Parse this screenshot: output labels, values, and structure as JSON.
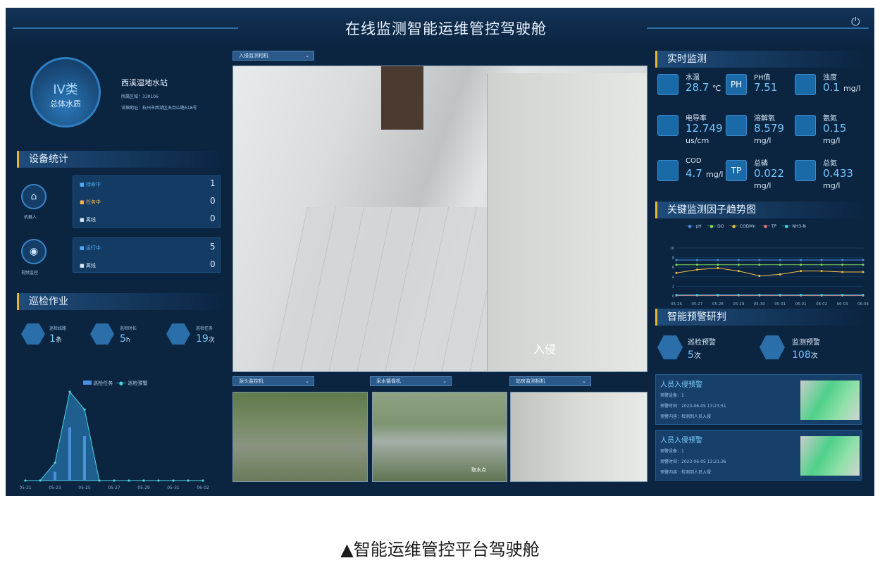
{
  "header": {
    "title": "在线监测智能运维管控驾驶舱"
  },
  "station": {
    "water_class": "IV类",
    "water_quality_label": "总体水质",
    "name": "西溪湿地水站",
    "region_label": "所属区域：",
    "region_value": "330106",
    "address_label": "详细地址：",
    "address_value": "杭州市西湖区天目山路518号"
  },
  "device_stats": {
    "title": "设备统计",
    "robot": {
      "label": "机器人",
      "rows": [
        {
          "label": "待命中",
          "value": "1"
        },
        {
          "label": "任务中",
          "value": "0"
        },
        {
          "label": "离线",
          "value": "0"
        }
      ]
    },
    "video": {
      "label": "视频监控",
      "rows": [
        {
          "label": "运行中",
          "value": "5"
        },
        {
          "label": "离线",
          "value": "0"
        }
      ]
    }
  },
  "inspection": {
    "title": "巡检作业",
    "items": [
      {
        "label": "巡检线路",
        "value": "1",
        "unit": "条"
      },
      {
        "label": "巡检时长",
        "value": "5",
        "unit": "h"
      },
      {
        "label": "巡检任务",
        "value": "19",
        "unit": "次"
      }
    ],
    "legend": [
      "巡检任务",
      "巡检预警"
    ],
    "x_ticks": [
      "05-21",
      "05-23",
      "05-25",
      "05-27",
      "05-29",
      "05-31",
      "06-02"
    ]
  },
  "cameras": {
    "main_select": "入侵监测相机",
    "main_overlay": "入侵",
    "sub": [
      {
        "label": "源头监控机"
      },
      {
        "label": "采水摄像机"
      },
      {
        "label": "站房监测相机"
      }
    ],
    "sub_overlay": "取水点"
  },
  "realtime": {
    "title": "实时监测",
    "items": [
      {
        "label": "水温",
        "value": "28.7",
        "unit": "℃",
        "icon": "thermometer-icon"
      },
      {
        "label": "PH值",
        "value": "7.51",
        "unit": "",
        "icon": "ph-icon",
        "badge": "PH"
      },
      {
        "label": "浊度",
        "value": "0.1",
        "unit": "mg/l",
        "icon": "drop-icon"
      },
      {
        "label": "电导率",
        "value": "12.749",
        "unit": "us/cm",
        "icon": "bolt-icon"
      },
      {
        "label": "溶解氧",
        "value": "8.579",
        "unit": "mg/l",
        "icon": "oxygen-icon"
      },
      {
        "label": "氨氮",
        "value": "0.15",
        "unit": "mg/l",
        "icon": "ammonia-icon"
      },
      {
        "label": "COD",
        "value": "4.7",
        "unit": "mg/l",
        "icon": "beaker-icon"
      },
      {
        "label": "总磷",
        "value": "0.022",
        "unit": "mg/l",
        "icon": "tp-icon",
        "badge": "TP"
      },
      {
        "label": "总氮",
        "value": "0.433",
        "unit": "mg/l",
        "icon": "tn-icon"
      }
    ]
  },
  "trend": {
    "title": "关键监测因子趋势图",
    "legend": [
      {
        "name": "pH",
        "color": "#4a8fe0"
      },
      {
        "name": "DO",
        "color": "#7ed957"
      },
      {
        "name": "CODMn",
        "color": "#f0c04a"
      },
      {
        "name": "TP",
        "color": "#f07a7a"
      },
      {
        "name": "NH3-N",
        "color": "#4fd3e0"
      }
    ],
    "y_ticks": [
      "10",
      "8",
      "6",
      "4",
      "2",
      "0"
    ],
    "x_ticks": [
      "05-26",
      "05-27",
      "05-28",
      "05-29",
      "05-30",
      "05-31",
      "06-01",
      "06-02",
      "06-03",
      "06-04"
    ]
  },
  "warning": {
    "title": "智能预警研判",
    "items": [
      {
        "label": "巡检预警",
        "value": "5",
        "unit": "次"
      },
      {
        "label": "监测预警",
        "value": "108",
        "unit": "次"
      }
    ],
    "alerts": [
      {
        "title": "人员入侵预警",
        "device": "预警设备：1",
        "time": "预警时间：2023-06-05 13:23:51",
        "content": "预警内容：检测到人员入侵"
      },
      {
        "title": "人员入侵预警",
        "device": "预警设备：1",
        "time": "预警时间：2023-06-05 13:21:36",
        "content": "预警内容：检测到人员入侵"
      }
    ]
  },
  "chart_data": [
    {
      "type": "line",
      "title": "关键监测因子趋势图",
      "x": [
        "05-26",
        "05-27",
        "05-28",
        "05-29",
        "05-30",
        "05-31",
        "06-01",
        "06-02",
        "06-03",
        "06-04"
      ],
      "ylim": [
        0,
        10
      ],
      "series": [
        {
          "name": "pH",
          "values": [
            7.5,
            7.5,
            7.5,
            7.5,
            7.5,
            7.5,
            7.5,
            7.5,
            7.5,
            7.5
          ]
        },
        {
          "name": "DO",
          "values": [
            6.5,
            6.5,
            6.5,
            6.5,
            6.5,
            6.5,
            6.5,
            6.5,
            6.5,
            6.5
          ]
        },
        {
          "name": "CODMn",
          "values": [
            4.8,
            5.5,
            5.8,
            5.2,
            4.2,
            4.5,
            5.2,
            5.2,
            5.0,
            5.0
          ]
        },
        {
          "name": "TP",
          "values": [
            0.1,
            0.1,
            0.1,
            0.1,
            0.1,
            0.1,
            0.1,
            0.1,
            0.1,
            0.1
          ]
        },
        {
          "name": "NH3-N",
          "values": [
            0.2,
            0.2,
            0.2,
            0.2,
            0.2,
            0.2,
            0.2,
            0.2,
            0.2,
            0.2
          ]
        }
      ]
    },
    {
      "type": "area",
      "categories": [
        "05-21",
        "05-22",
        "05-23",
        "05-24",
        "05-25",
        "05-26",
        "05-27",
        "05-28",
        "05-29",
        "05-30",
        "05-31",
        "06-01",
        "06-02"
      ],
      "series": [
        {
          "name": "巡检任务",
          "values": [
            0,
            0,
            1,
            6,
            5,
            0,
            0,
            0,
            0,
            0,
            0,
            0,
            0
          ]
        },
        {
          "name": "巡检预警",
          "values": [
            0,
            0,
            2,
            10,
            8,
            0,
            0,
            0,
            0,
            0,
            0,
            0,
            0
          ]
        }
      ]
    }
  ],
  "caption": "▲智能运维管控平台驾驶舱"
}
